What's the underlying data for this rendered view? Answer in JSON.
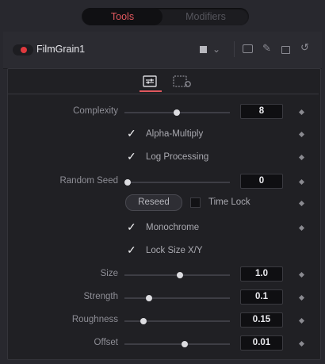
{
  "tabs": {
    "active": "Tools",
    "inactive": "Modifiers"
  },
  "node": {
    "name": "FilmGrain1",
    "enabled_color": "#e0393e"
  },
  "accent": "#e0585e",
  "header_icons": [
    "color-swatch-icon",
    "chevron-down-icon",
    "pip-icon",
    "pin-icon",
    "lock-icon",
    "reset-icon"
  ],
  "subtabs": [
    {
      "name": "controls-tab-icon",
      "active": true
    },
    {
      "name": "settings-tab-icon",
      "active": false
    }
  ],
  "controls": {
    "complexity": {
      "label": "Complexity",
      "value": "8",
      "slider_fraction": 0.5
    },
    "alpha_multiply": {
      "label": "Alpha-Multiply",
      "checked": true
    },
    "log_processing": {
      "label": "Log Processing",
      "checked": true
    },
    "random_seed": {
      "label": "Random Seed",
      "value": "0",
      "slider_fraction": 0.0
    },
    "reseed": {
      "label": "Reseed"
    },
    "time_lock": {
      "label": "Time Lock",
      "checked": false
    },
    "monochrome": {
      "label": "Monochrome",
      "checked": true
    },
    "lock_size_xy": {
      "label": "Lock Size X/Y",
      "checked": true
    },
    "size": {
      "label": "Size",
      "value": "1.0",
      "slider_fraction": 0.5
    },
    "strength": {
      "label": "Strength",
      "value": "0.1",
      "slider_fraction": 0.2
    },
    "roughness": {
      "label": "Roughness",
      "value": "0.15",
      "slider_fraction": 0.15
    },
    "offset": {
      "label": "Offset",
      "value": "0.01",
      "slider_fraction": 0.55
    }
  }
}
